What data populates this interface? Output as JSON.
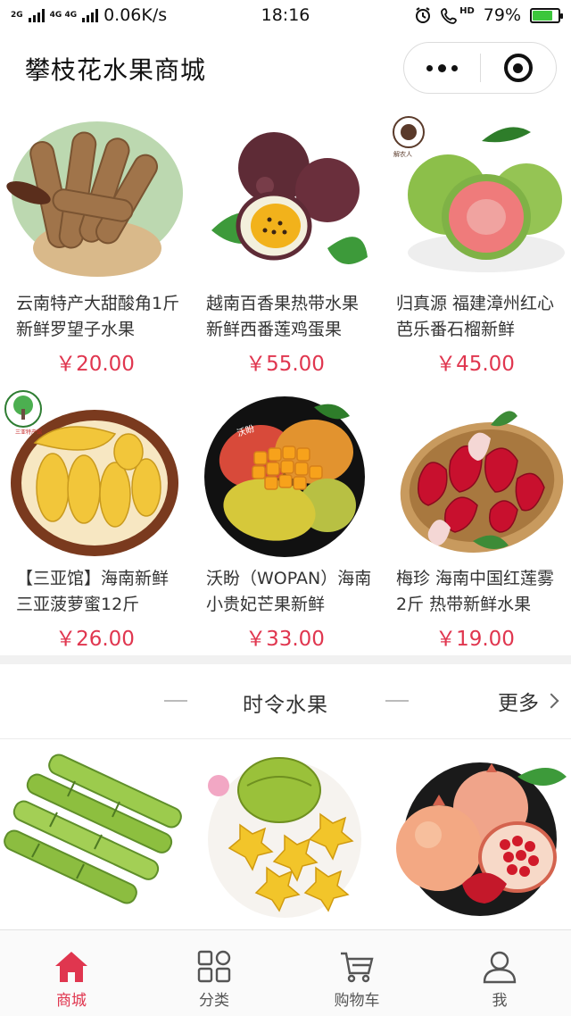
{
  "status_bar": {
    "network_primary": "2G",
    "network_secondary": "4G 4G",
    "speed": "0.06K/s",
    "time": "18:16",
    "hd": "HD",
    "battery": "79%",
    "battery_level": 0.79,
    "icons": [
      "signal-icon",
      "alarm-icon",
      "call-hd-icon",
      "battery-icon"
    ]
  },
  "header": {
    "title": "攀枝花水果商城",
    "menu_icon": "more-dots-icon",
    "close_icon": "target-circle-icon"
  },
  "products": [
    {
      "name": "云南特产大甜酸角1斤 新鲜罗望子水果",
      "price": "￥20.00"
    },
    {
      "name": "越南百香果热带水果新鲜西番莲鸡蛋果",
      "price": "￥55.00"
    },
    {
      "name": "归真源 福建漳州红心芭乐番石榴新鲜",
      "price": "￥45.00",
      "badge": "解农人"
    },
    {
      "name": "【三亚馆】海南新鲜三亚菠萝蜜12斤",
      "price": "￥26.00",
      "badge": "三亚特产馆"
    },
    {
      "name": "沃盼（WOPAN）海南小贵妃芒果新鲜",
      "price": "￥33.00",
      "badge": "沃盼"
    },
    {
      "name": "梅珍 海南中国红莲雾2斤 热带新鲜水果",
      "price": "￥19.00"
    }
  ],
  "section": {
    "title": "时令水果",
    "more_label": "更多"
  },
  "tabs": [
    {
      "label": "商城",
      "icon": "home-icon",
      "active": true
    },
    {
      "label": "分类",
      "icon": "grid-icon",
      "active": false
    },
    {
      "label": "购物车",
      "icon": "cart-icon",
      "active": false
    },
    {
      "label": "我",
      "icon": "user-icon",
      "active": false
    }
  ],
  "colors": {
    "price": "#e0364f",
    "active_tab": "#e0364f",
    "inactive_tab": "#555555"
  }
}
